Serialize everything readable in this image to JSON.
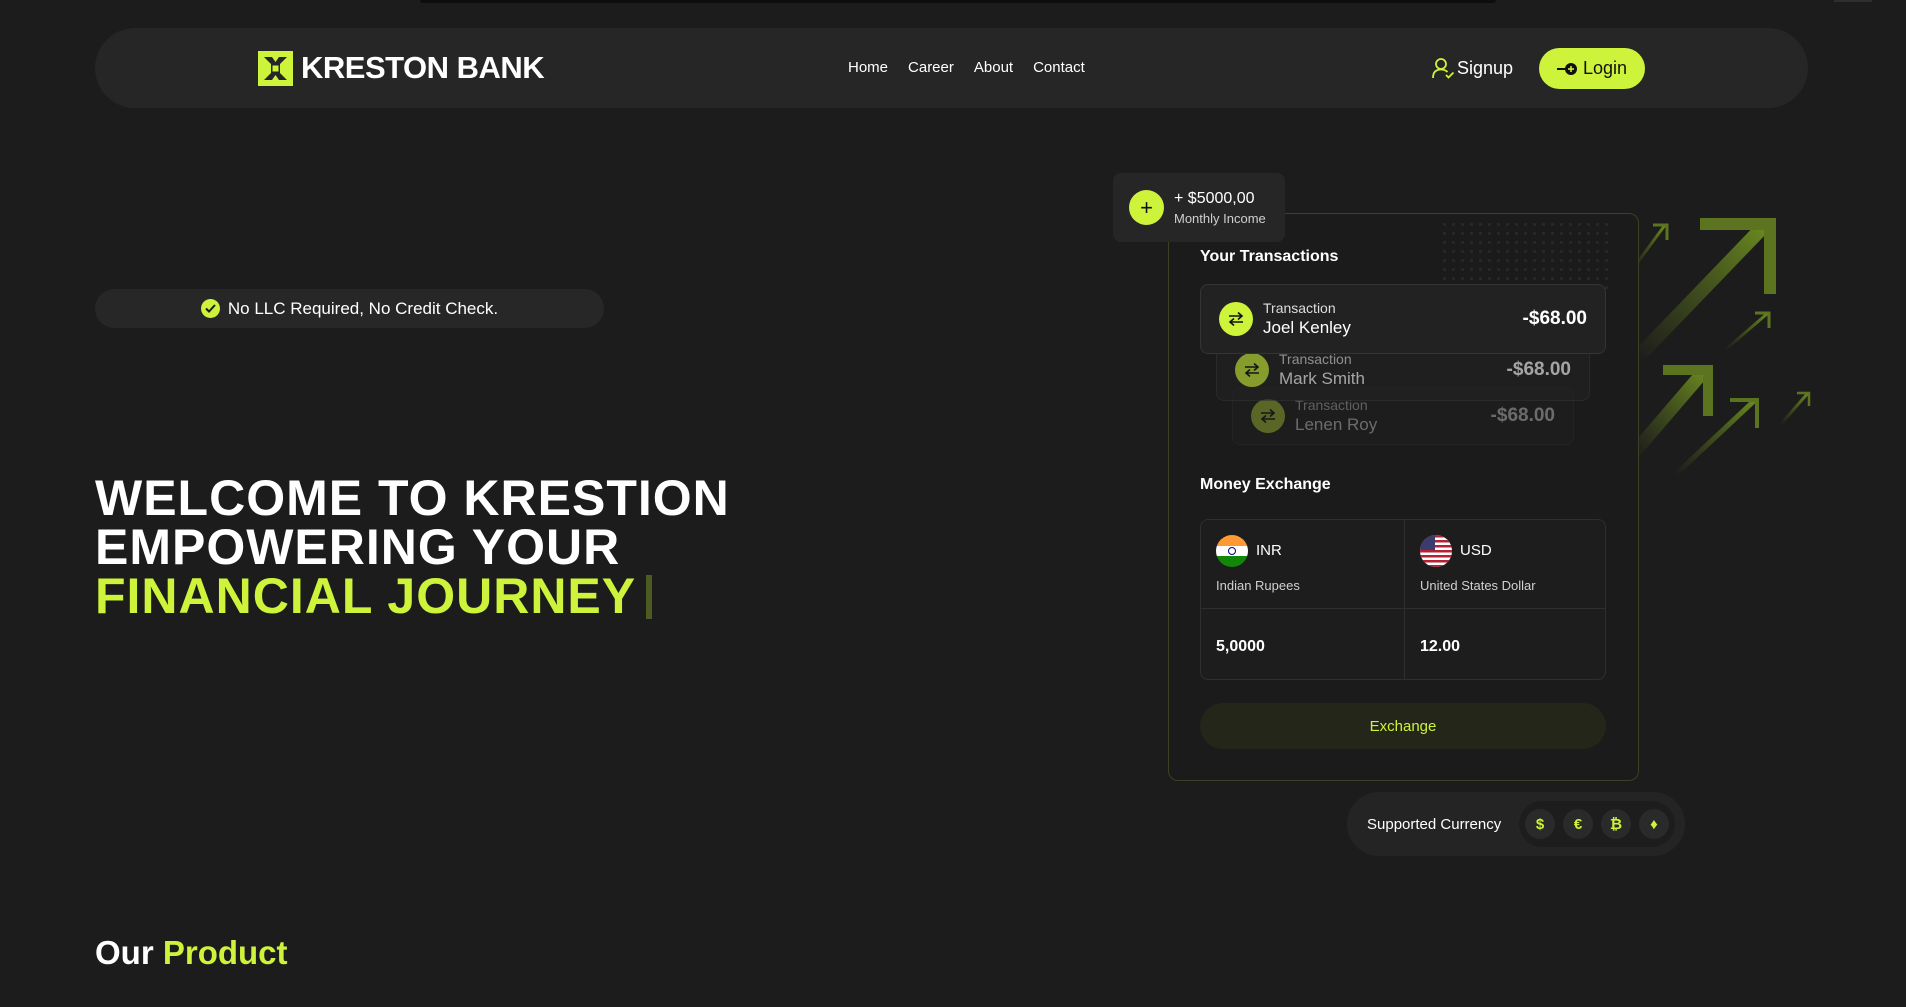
{
  "brand": {
    "name": "KRESTON BANK",
    "accent": "#cdf33a",
    "background": "#1c1c1c"
  },
  "nav": {
    "links": [
      "Home",
      "Career",
      "About",
      "Contact"
    ],
    "signup": "Signup",
    "login": "Login"
  },
  "badge": "No LLC Required, No Credit Check.",
  "hero": {
    "line1": "WELCOME TO KRESTION",
    "line2": "EMPOWERING YOUR",
    "line3": "FINANCIAL JOURNEY"
  },
  "income": {
    "amount": "+ $5000,00",
    "label": "Monthly Income"
  },
  "transactions": {
    "title": "Your Transactions",
    "items": [
      {
        "label": "Transaction",
        "name": "Joel Kenley",
        "amount": "-$68.00"
      },
      {
        "label": "Transaction",
        "name": "Mark Smith",
        "amount": "-$68.00"
      },
      {
        "label": "Transaction",
        "name": "Lenen Roy",
        "amount": "-$68.00"
      }
    ]
  },
  "exchange": {
    "title": "Money Exchange",
    "from": {
      "code": "INR",
      "name": "Indian Rupees",
      "value": "5,0000",
      "flag": "india-flag"
    },
    "to": {
      "code": "USD",
      "name": "United States Dollar",
      "value": "12.00",
      "flag": "us-flag"
    },
    "button": "Exchange"
  },
  "supported": {
    "label": "Supported Currency",
    "icons": [
      {
        "name": "dollar-icon",
        "glyph": "$"
      },
      {
        "name": "euro-icon",
        "glyph": "€"
      },
      {
        "name": "bitcoin-icon",
        "glyph": "₿"
      },
      {
        "name": "ethereum-icon",
        "glyph": "♦"
      }
    ]
  },
  "section": {
    "title_a": "Our",
    "title_b": "Product"
  }
}
